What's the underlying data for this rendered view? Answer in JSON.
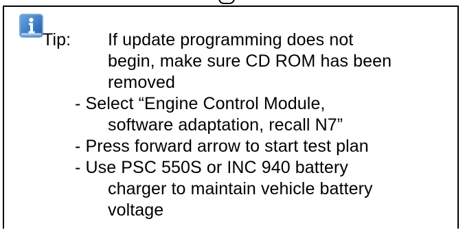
{
  "tip": {
    "icon": "info-icon",
    "label": "Tip:",
    "lines": [
      "If update programming does not",
      "begin, make sure CD ROM has been",
      "removed"
    ]
  },
  "bullets": [
    {
      "lines": [
        "- Select “Engine  Control Module,",
        "software adaptation, recall N7”"
      ]
    },
    {
      "lines": [
        "- Press forward arrow to start test plan"
      ]
    },
    {
      "lines": [
        "- Use PSC 550S or INC 940 battery",
        "charger to maintain vehicle battery",
        "voltage"
      ]
    }
  ],
  "colors": {
    "icon_fill": "#2f6fb8",
    "icon_border": "#7fa9d6",
    "border": "#000000"
  }
}
